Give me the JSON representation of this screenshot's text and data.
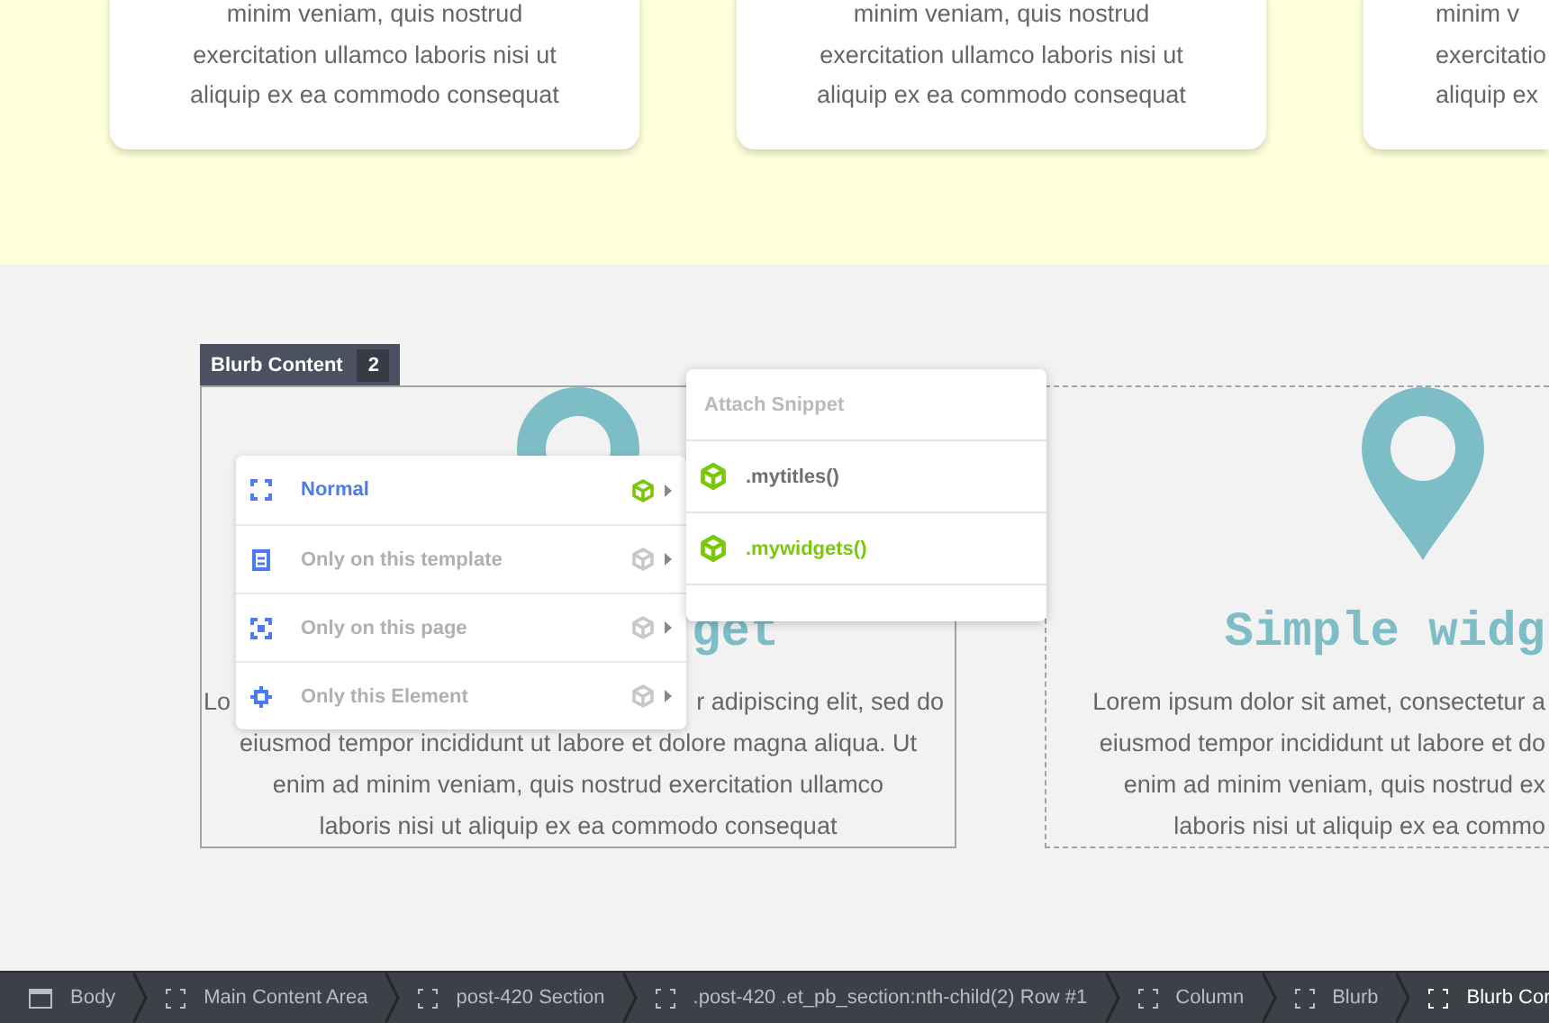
{
  "top_cards": [
    {
      "lines": [
        "minim veniam, quis nostrud",
        "exercitation ullamco laboris nisi ut",
        "aliquip ex ea commodo consequat"
      ]
    },
    {
      "lines": [
        "minim veniam, quis nostrud",
        "exercitation ullamco laboris nisi ut",
        "aliquip ex ea commodo consequat"
      ]
    },
    {
      "lines": [
        "minim v",
        "exercitatio",
        "aliquip ex"
      ]
    }
  ],
  "blurbs": [
    {
      "selected": true,
      "tag": {
        "label": "Blurb Content",
        "count": "2"
      },
      "title": "get",
      "lines": [
        [
          "Lo",
          "r adipiscing elit, sed do"
        ],
        [
          "eiusmod tempor incididunt ut labore et dolore magna aliqua. Ut"
        ],
        [
          "enim ad minim veniam, quis nostrud exercitation ullamco"
        ],
        [
          "laboris nisi ut aliquip ex ea commodo consequat"
        ]
      ]
    },
    {
      "selected": false,
      "title": "Simple widg",
      "lines": [
        [
          "Lorem ipsum dolor sit amet, consectetur a"
        ],
        [
          "eiusmod tempor incididunt ut labore et do"
        ],
        [
          "enim ad minim veniam, quis nostrud ex"
        ],
        [
          "laboris nisi ut aliquip ex ea commo"
        ]
      ]
    }
  ],
  "context_menu": {
    "items": [
      {
        "kind": "normal",
        "label": "Normal",
        "selected": true
      },
      {
        "kind": "template",
        "label": "Only on this template",
        "selected": false
      },
      {
        "kind": "page",
        "label": "Only on this page",
        "selected": false
      },
      {
        "kind": "element",
        "label": "Only this Element",
        "selected": false
      }
    ]
  },
  "snippet_menu": {
    "header": "Attach Snippet",
    "items": [
      {
        "label": ".mytitles()",
        "selected": false
      },
      {
        "label": ".mywidgets()",
        "selected": true
      }
    ]
  },
  "breadcrumbs": [
    {
      "kind": "body",
      "label": "Body",
      "selected": false
    },
    {
      "kind": "module",
      "label": "Main Content Area",
      "selected": false
    },
    {
      "kind": "module",
      "label": "post-420 Section",
      "selected": false
    },
    {
      "kind": "module",
      "label": ".post-420 .et_pb_section:nth-child(2) Row #1",
      "selected": false
    },
    {
      "kind": "module",
      "label": "Column",
      "selected": false
    },
    {
      "kind": "module",
      "label": "Blurb",
      "selected": false
    },
    {
      "kind": "module",
      "label": "Blurb Cor",
      "selected": true
    }
  ]
}
